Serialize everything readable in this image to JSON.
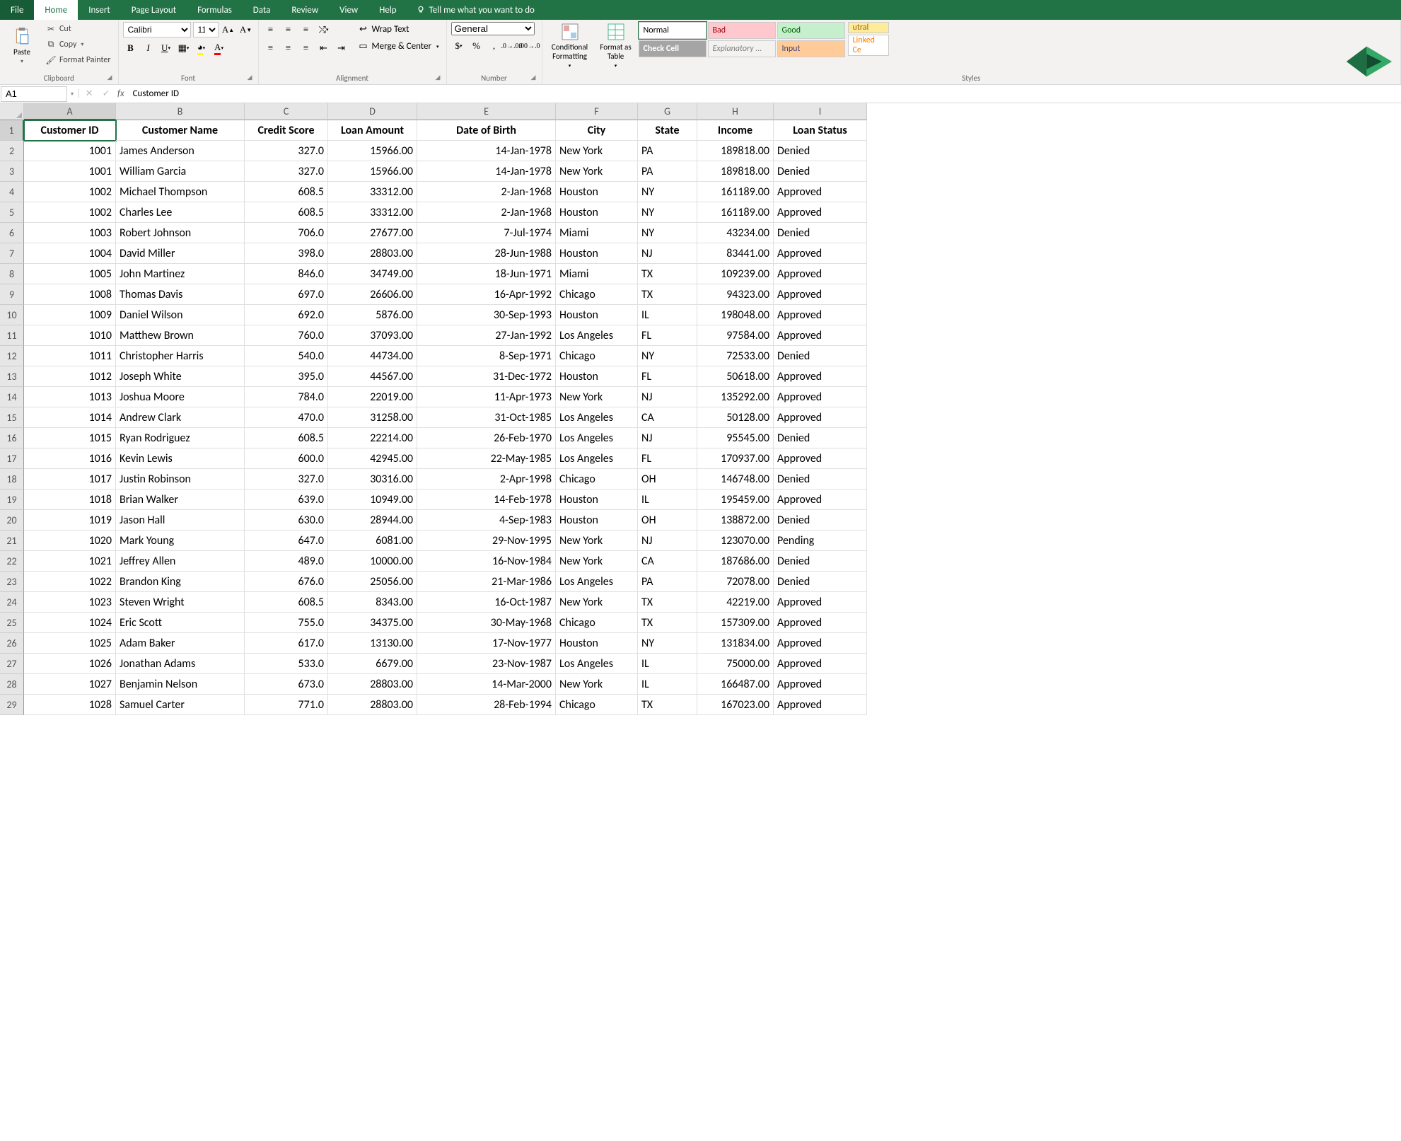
{
  "tabs": {
    "file": "File",
    "home": "Home",
    "insert": "Insert",
    "pageLayout": "Page Layout",
    "formulas": "Formulas",
    "data": "Data",
    "review": "Review",
    "view": "View",
    "help": "Help",
    "tellme": "Tell me what you want to do"
  },
  "ribbon": {
    "clipboard": {
      "paste": "Paste",
      "cut": "Cut",
      "copy": "Copy",
      "formatPainter": "Format Painter",
      "label": "Clipboard"
    },
    "font": {
      "name": "Calibri",
      "size": "11",
      "label": "Font"
    },
    "alignment": {
      "wrap": "Wrap Text",
      "merge": "Merge & Center",
      "label": "Alignment"
    },
    "number": {
      "format": "General",
      "label": "Number"
    },
    "stylesGroup": {
      "cond": "Conditional Formatting",
      "fmtTable": "Format as Table",
      "label": "Styles",
      "cells": {
        "normal": "Normal",
        "bad": "Bad",
        "good": "Good",
        "neutral": "utral",
        "check": "Check Cell",
        "expl": "Explanatory ...",
        "input": "Input",
        "linked": "Linked Ce"
      }
    }
  },
  "namebox": "A1",
  "formula": "Customer ID",
  "columns": [
    "A",
    "B",
    "C",
    "D",
    "E",
    "F",
    "G",
    "H",
    "I"
  ],
  "headers": {
    "A": "Customer ID",
    "B": "Customer Name",
    "C": "Credit Score",
    "D": "Loan Amount",
    "E": "Date of Birth",
    "F": "City",
    "G": "State",
    "H": "Income",
    "I": "Loan Status"
  },
  "rows": [
    {
      "A": "1001",
      "B": "James Anderson",
      "C": "327.0",
      "D": "15966.00",
      "E": "14-Jan-1978",
      "F": "New York",
      "G": "PA",
      "H": "189818.00",
      "I": "Denied"
    },
    {
      "A": "1001",
      "B": "William Garcia",
      "C": "327.0",
      "D": "15966.00",
      "E": "14-Jan-1978",
      "F": "New York",
      "G": "PA",
      "H": "189818.00",
      "I": "Denied"
    },
    {
      "A": "1002",
      "B": "Michael Thompson",
      "C": "608.5",
      "D": "33312.00",
      "E": "2-Jan-1968",
      "F": "Houston",
      "G": "NY",
      "H": "161189.00",
      "I": "Approved"
    },
    {
      "A": "1002",
      "B": "Charles Lee",
      "C": "608.5",
      "D": "33312.00",
      "E": "2-Jan-1968",
      "F": "Houston",
      "G": "NY",
      "H": "161189.00",
      "I": "Approved"
    },
    {
      "A": "1003",
      "B": "Robert Johnson",
      "C": "706.0",
      "D": "27677.00",
      "E": "7-Jul-1974",
      "F": "Miami",
      "G": "NY",
      "H": "43234.00",
      "I": "Denied"
    },
    {
      "A": "1004",
      "B": "David Miller",
      "C": "398.0",
      "D": "28803.00",
      "E": "28-Jun-1988",
      "F": "Houston",
      "G": "NJ",
      "H": "83441.00",
      "I": "Approved"
    },
    {
      "A": "1005",
      "B": "John Martinez",
      "C": "846.0",
      "D": "34749.00",
      "E": "18-Jun-1971",
      "F": "Miami",
      "G": "TX",
      "H": "109239.00",
      "I": "Approved"
    },
    {
      "A": "1008",
      "B": "Thomas Davis",
      "C": "697.0",
      "D": "26606.00",
      "E": "16-Apr-1992",
      "F": "Chicago",
      "G": "TX",
      "H": "94323.00",
      "I": "Approved"
    },
    {
      "A": "1009",
      "B": "Daniel Wilson",
      "C": "692.0",
      "D": "5876.00",
      "E": "30-Sep-1993",
      "F": "Houston",
      "G": "IL",
      "H": "198048.00",
      "I": "Approved"
    },
    {
      "A": "1010",
      "B": "Matthew Brown",
      "C": "760.0",
      "D": "37093.00",
      "E": "27-Jan-1992",
      "F": "Los Angeles",
      "G": "FL",
      "H": "97584.00",
      "I": "Approved"
    },
    {
      "A": "1011",
      "B": "Christopher Harris",
      "C": "540.0",
      "D": "44734.00",
      "E": "8-Sep-1971",
      "F": "Chicago",
      "G": "NY",
      "H": "72533.00",
      "I": "Denied"
    },
    {
      "A": "1012",
      "B": "Joseph White",
      "C": "395.0",
      "D": "44567.00",
      "E": "31-Dec-1972",
      "F": "Houston",
      "G": "FL",
      "H": "50618.00",
      "I": "Approved"
    },
    {
      "A": "1013",
      "B": "Joshua Moore",
      "C": "784.0",
      "D": "22019.00",
      "E": "11-Apr-1973",
      "F": "New York",
      "G": "NJ",
      "H": "135292.00",
      "I": "Approved"
    },
    {
      "A": "1014",
      "B": "Andrew Clark",
      "C": "470.0",
      "D": "31258.00",
      "E": "31-Oct-1985",
      "F": "Los Angeles",
      "G": "CA",
      "H": "50128.00",
      "I": "Approved"
    },
    {
      "A": "1015",
      "B": "Ryan Rodriguez",
      "C": "608.5",
      "D": "22214.00",
      "E": "26-Feb-1970",
      "F": "Los Angeles",
      "G": "NJ",
      "H": "95545.00",
      "I": "Denied"
    },
    {
      "A": "1016",
      "B": "Kevin Lewis",
      "C": "600.0",
      "D": "42945.00",
      "E": "22-May-1985",
      "F": "Los Angeles",
      "G": "FL",
      "H": "170937.00",
      "I": "Approved"
    },
    {
      "A": "1017",
      "B": "Justin Robinson",
      "C": "327.0",
      "D": "30316.00",
      "E": "2-Apr-1998",
      "F": "Chicago",
      "G": "OH",
      "H": "146748.00",
      "I": "Denied"
    },
    {
      "A": "1018",
      "B": "Brian Walker",
      "C": "639.0",
      "D": "10949.00",
      "E": "14-Feb-1978",
      "F": "Houston",
      "G": "IL",
      "H": "195459.00",
      "I": "Approved"
    },
    {
      "A": "1019",
      "B": "Jason Hall",
      "C": "630.0",
      "D": "28944.00",
      "E": "4-Sep-1983",
      "F": "Houston",
      "G": "OH",
      "H": "138872.00",
      "I": "Denied"
    },
    {
      "A": "1020",
      "B": "Mark Young",
      "C": "647.0",
      "D": "6081.00",
      "E": "29-Nov-1995",
      "F": "New York",
      "G": "NJ",
      "H": "123070.00",
      "I": "Pending"
    },
    {
      "A": "1021",
      "B": "Jeffrey Allen",
      "C": "489.0",
      "D": "10000.00",
      "E": "16-Nov-1984",
      "F": "New York",
      "G": "CA",
      "H": "187686.00",
      "I": "Denied"
    },
    {
      "A": "1022",
      "B": "Brandon King",
      "C": "676.0",
      "D": "25056.00",
      "E": "21-Mar-1986",
      "F": "Los Angeles",
      "G": "PA",
      "H": "72078.00",
      "I": "Denied"
    },
    {
      "A": "1023",
      "B": "Steven Wright",
      "C": "608.5",
      "D": "8343.00",
      "E": "16-Oct-1987",
      "F": "New York",
      "G": "TX",
      "H": "42219.00",
      "I": "Approved"
    },
    {
      "A": "1024",
      "B": "Eric Scott",
      "C": "755.0",
      "D": "34375.00",
      "E": "30-May-1968",
      "F": "Chicago",
      "G": "TX",
      "H": "157309.00",
      "I": "Approved"
    },
    {
      "A": "1025",
      "B": "Adam Baker",
      "C": "617.0",
      "D": "13130.00",
      "E": "17-Nov-1977",
      "F": "Houston",
      "G": "NY",
      "H": "131834.00",
      "I": "Approved"
    },
    {
      "A": "1026",
      "B": "Jonathan Adams",
      "C": "533.0",
      "D": "6679.00",
      "E": "23-Nov-1987",
      "F": "Los Angeles",
      "G": "IL",
      "H": "75000.00",
      "I": "Approved"
    },
    {
      "A": "1027",
      "B": "Benjamin Nelson",
      "C": "673.0",
      "D": "28803.00",
      "E": "14-Mar-2000",
      "F": "New York",
      "G": "IL",
      "H": "166487.00",
      "I": "Approved"
    },
    {
      "A": "1028",
      "B": "Samuel Carter",
      "C": "771.0",
      "D": "28803.00",
      "E": "28-Feb-1994",
      "F": "Chicago",
      "G": "TX",
      "H": "167023.00",
      "I": "Approved"
    }
  ],
  "numericCols": [
    "A",
    "C",
    "D",
    "E",
    "H"
  ]
}
